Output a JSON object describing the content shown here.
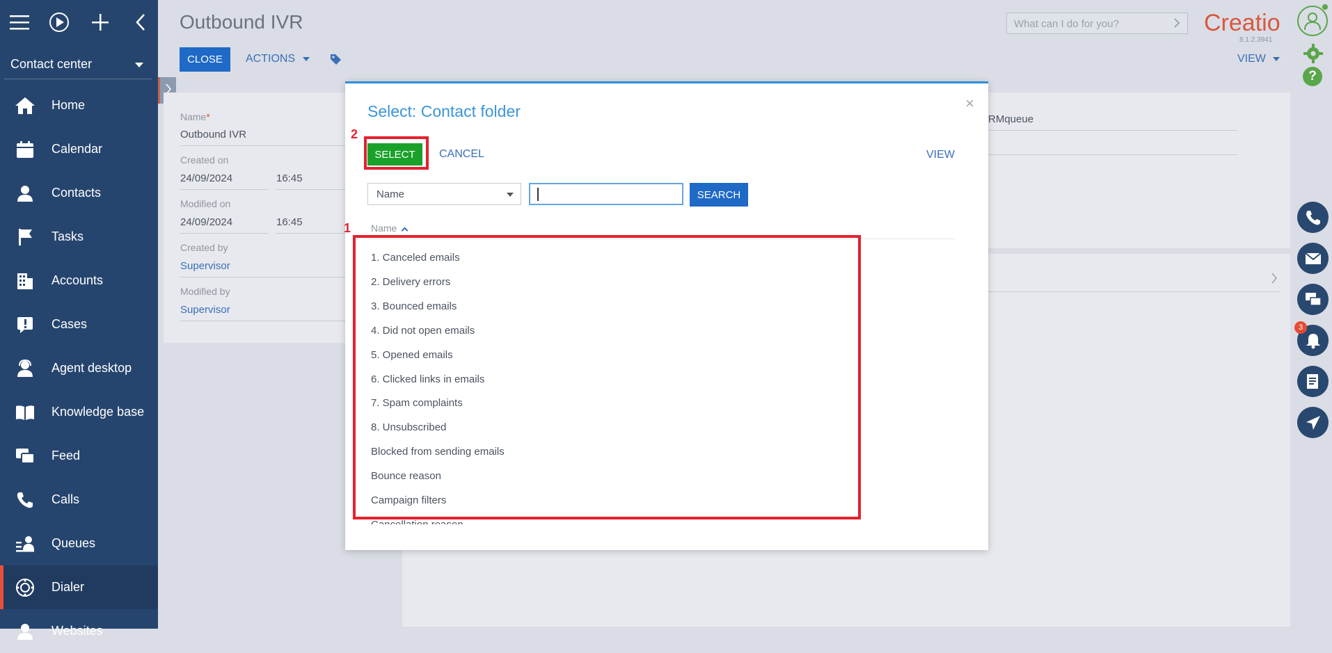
{
  "sidebar": {
    "workspace": "Contact center",
    "items": [
      {
        "label": "Home",
        "icon": "home-icon"
      },
      {
        "label": "Calendar",
        "icon": "calendar-icon"
      },
      {
        "label": "Contacts",
        "icon": "person-icon"
      },
      {
        "label": "Tasks",
        "icon": "flag-icon"
      },
      {
        "label": "Accounts",
        "icon": "building-icon"
      },
      {
        "label": "Cases",
        "icon": "case-icon"
      },
      {
        "label": "Agent desktop",
        "icon": "agent-icon"
      },
      {
        "label": "Knowledge base",
        "icon": "book-icon"
      },
      {
        "label": "Feed",
        "icon": "feed-icon"
      },
      {
        "label": "Calls",
        "icon": "phone-icon"
      },
      {
        "label": "Queues",
        "icon": "queue-icon"
      },
      {
        "label": "Dialer",
        "icon": "dialer-icon"
      },
      {
        "label": "Websites",
        "icon": "person-icon"
      }
    ]
  },
  "header": {
    "title": "Outbound IVR",
    "close_label": "CLOSE",
    "actions_label": "ACTIONS",
    "search_placeholder": "What can I do for you?",
    "brand": "Creatio",
    "version": "8.1.2.3941",
    "view_label": "VIEW"
  },
  "form": {
    "name_label": "Name",
    "name_required": "*",
    "name_value": "Outbound IVR",
    "created_on_label": "Created on",
    "created_on_date": "24/09/2024",
    "created_on_time": "16:45",
    "modified_on_label": "Modified on",
    "modified_on_date": "24/09/2024",
    "modified_on_time": "16:45",
    "created_by_label": "Created by",
    "created_by_value": "Supervisor",
    "modified_by_label": "Modified by",
    "modified_by_value": "Supervisor",
    "queue_value_fragment": "RMqueue"
  },
  "modal": {
    "title": "Select: Contact folder",
    "select_label": "SELECT",
    "cancel_label": "CANCEL",
    "view_label": "VIEW",
    "filter_field": "Name",
    "search_label": "SEARCH",
    "column_header": "Name",
    "rows": [
      "1. Canceled emails",
      "2. Delivery errors",
      "3. Bounced emails",
      "4. Did not open emails",
      "5. Opened emails",
      "6. Clicked links in emails",
      "7. Spam complaints",
      "8. Unsubscribed",
      "Blocked from sending emails",
      "Bounce reason",
      "Campaign filters",
      "Cancellation reason"
    ]
  },
  "annotations": {
    "one": "1",
    "two": "2"
  },
  "notifications_count": "3",
  "colors": {
    "sidebar": "#26456e",
    "primary": "#1f69c7",
    "select_green": "#1aa12a",
    "highlight_red": "#e5212e",
    "brand": "#d9573f"
  }
}
